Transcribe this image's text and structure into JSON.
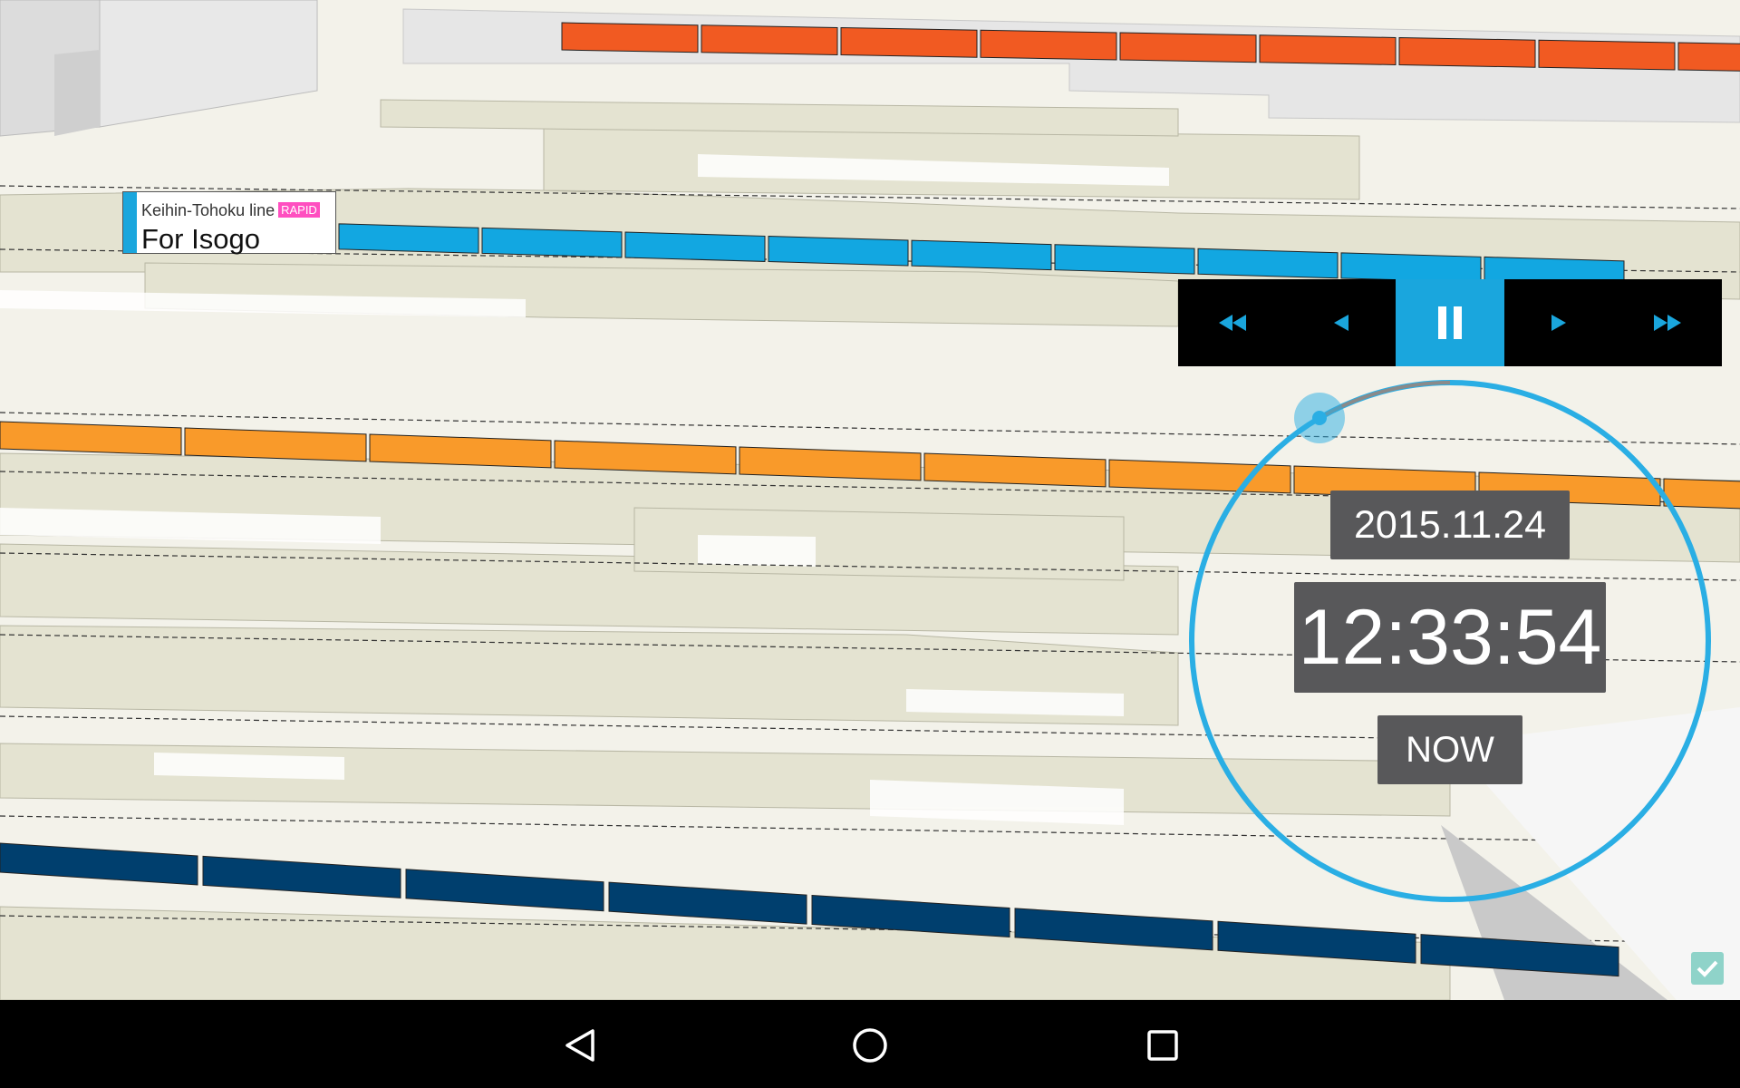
{
  "train_label": {
    "line_name": "Keihin-Tohoku line",
    "badge": "RAPID",
    "destination": "For Isogo",
    "color": "#1aa6dd",
    "badge_color": "#ff4fc0"
  },
  "playback_controls": {
    "buttons": [
      {
        "name": "fast-rewind",
        "icon": "fast-rewind-icon"
      },
      {
        "name": "step-back",
        "icon": "step-back-icon"
      },
      {
        "name": "pause",
        "icon": "pause-icon",
        "active": true
      },
      {
        "name": "step-forward",
        "icon": "step-forward-icon"
      },
      {
        "name": "fast-forward",
        "icon": "fast-forward-icon"
      }
    ],
    "active_color": "#1aa6dd"
  },
  "clock": {
    "date": "2015.11.24",
    "time": "12:33:54",
    "now_label": "NOW",
    "ring_color": "#2aaee4"
  },
  "trains": [
    {
      "line": "orange-red",
      "color": "#f15a22"
    },
    {
      "line": "keihin-tohoku",
      "color": "#12a7e1"
    },
    {
      "line": "chuo",
      "color": "#f99a2a"
    },
    {
      "line": "navy",
      "color": "#003f6e"
    }
  ],
  "navbar": {
    "buttons": [
      {
        "name": "back",
        "icon": "back-triangle-icon"
      },
      {
        "name": "home",
        "icon": "home-circle-icon"
      },
      {
        "name": "recents",
        "icon": "recents-square-icon"
      }
    ]
  },
  "settings_check": {
    "icon": "checkbox-icon",
    "color": "#8fd3c9"
  }
}
